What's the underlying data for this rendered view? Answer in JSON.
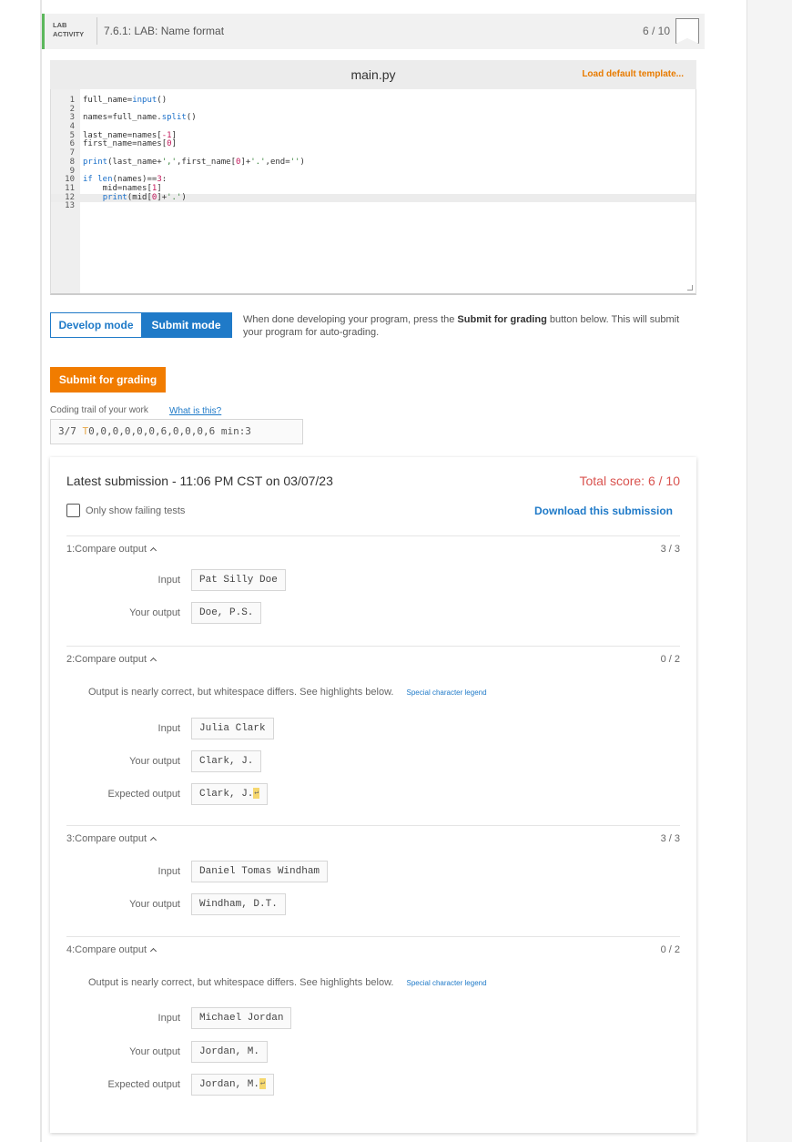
{
  "header": {
    "tag_line1": "LAB",
    "tag_line2": "ACTIVITY",
    "title": "7.6.1: LAB: Name format",
    "score": "6 / 10"
  },
  "editor": {
    "file_name": "main.py",
    "load_label": "Load default template...",
    "lines": [
      "full_name=input()",
      "",
      "names=full_name.split()",
      "",
      "last_name=names[-1]",
      "first_name=names[0]",
      "",
      "print(last_name+',',first_name[0]+'.',end='')",
      "",
      "if len(names)==3:",
      "    mid=names[1]",
      "    print(mid[0]+'.')",
      ""
    ]
  },
  "modes": {
    "develop_label": "Develop mode",
    "submit_label": "Submit mode",
    "desc_part1": "When done developing your program, press the ",
    "desc_bold": "Submit for grading",
    "desc_part2": " button below. This will submit your program for auto-grading."
  },
  "submit_button": "Submit for grading",
  "trail": {
    "label": "Coding trail of your work",
    "link": "What is this?",
    "prefix": "3/7 ",
    "t": "T",
    "values": "0,0,0,0,0,0,6,0,0,0,6 min:3"
  },
  "results": {
    "latest": "Latest submission - 11:06 PM CST on 03/07/23",
    "total": "Total score: 6 / 10",
    "only_failing": "Only show failing tests",
    "download": "Download this submission",
    "tests": [
      {
        "title": "1:Compare output",
        "score": "3 / 3",
        "input_label": "Input",
        "input": "Pat Silly Doe",
        "your_label": "Your output",
        "your_output": "Doe, P.S."
      },
      {
        "title": "2:Compare output",
        "score": "0 / 2",
        "note": "Output is nearly correct, but whitespace differs. See highlights below.",
        "legend": "Special character legend",
        "input_label": "Input",
        "input": "Julia Clark",
        "your_label": "Your output",
        "your_output": "Clark, J.",
        "expected_label": "Expected output",
        "expected": "Clark, J."
      },
      {
        "title": "3:Compare output",
        "score": "3 / 3",
        "input_label": "Input",
        "input": "Daniel Tomas Windham",
        "your_label": "Your output",
        "your_output": "Windham, D.T."
      },
      {
        "title": "4:Compare output",
        "score": "0 / 2",
        "note": "Output is nearly correct, but whitespace differs. See highlights below.",
        "legend": "Special character legend",
        "input_label": "Input",
        "input": "Michael Jordan",
        "your_label": "Your output",
        "your_output": "Jordan, M.",
        "expected_label": "Expected output",
        "expected": "Jordan, M."
      }
    ]
  },
  "colors": {
    "accent_blue": "#1f7ac8",
    "submit_orange": "#f17c00",
    "score_red": "#d9534f",
    "lab_green": "#5cb85c"
  },
  "icons": {
    "newline_marker": "↵"
  }
}
